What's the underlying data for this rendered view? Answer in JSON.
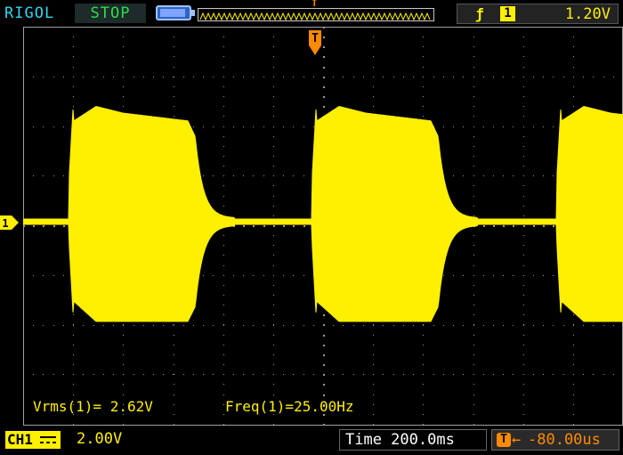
{
  "header": {
    "brand": "RIGOL",
    "run_state": "STOP",
    "memory_icon": "memory-depth-icon",
    "trigger_marker": "T",
    "trigger": {
      "edge_icon": "rising-edge-icon",
      "edge_glyph": "ƒ",
      "source": "1",
      "level": "1.20V"
    }
  },
  "screen": {
    "trigger_position_marker": "T",
    "channel_marker": "1",
    "measurements": {
      "vrms": "Vrms(1)= 2.62V",
      "freq": "Freq(1)=25.00Hz"
    }
  },
  "footer": {
    "channel_label": "CH1",
    "coupling_icon": "dc-coupling-icon",
    "channel_scale": "2.00V",
    "timebase": "Time 200.0ms",
    "trigger_offset_icon": "T",
    "trigger_offset_arrow": "←",
    "trigger_offset": "-80.00us"
  },
  "colors": {
    "channel1": "#ffef00",
    "trigger": "#ff8a00",
    "brand": "#2fd6f0",
    "run_state": "#29e04a",
    "grid": "#9a9a9a"
  }
}
